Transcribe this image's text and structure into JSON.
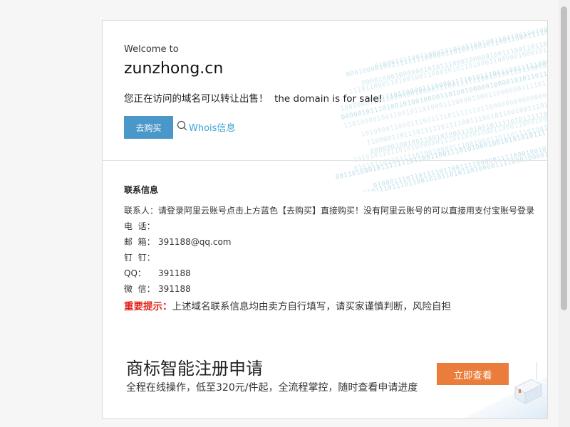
{
  "welcome": "Welcome to",
  "domain": "zunzhong.cn",
  "sale_text": "您正在访问的域名可以转让出售！  the domain is for sale!",
  "buy_button": "去购买",
  "whois_link": "Whois信息",
  "contact": {
    "title": "联系信息",
    "rows": [
      {
        "label": "联系人：",
        "value": "请登录阿里云账号点击上方蓝色【去购买】直接购买！没有阿里云账号的可以直接用支付宝账号登录"
      },
      {
        "label": "电  话：",
        "value": ""
      },
      {
        "label": "邮  箱：",
        "value": "391188@qq.com"
      },
      {
        "label": "钉  钉：",
        "value": ""
      },
      {
        "label": "QQ：",
        "value": "391188"
      },
      {
        "label": "微  信：",
        "value": "391188"
      }
    ]
  },
  "notice": {
    "label": "重要提示：",
    "text": "上述域名联系信息均由卖方自行填写，请买家谨慎判断，风险自担"
  },
  "ad": {
    "title": "商标智能注册申请",
    "subtitle": "全程在线操作，低至320元/件起，全流程掌控，随时查看申请进度",
    "button": "立即查看"
  },
  "colors": {
    "buy_button": "#4a97c9",
    "whois_link": "#3ea3d4",
    "warning": "#e2231a",
    "ad_button": "#ea7d3c"
  }
}
